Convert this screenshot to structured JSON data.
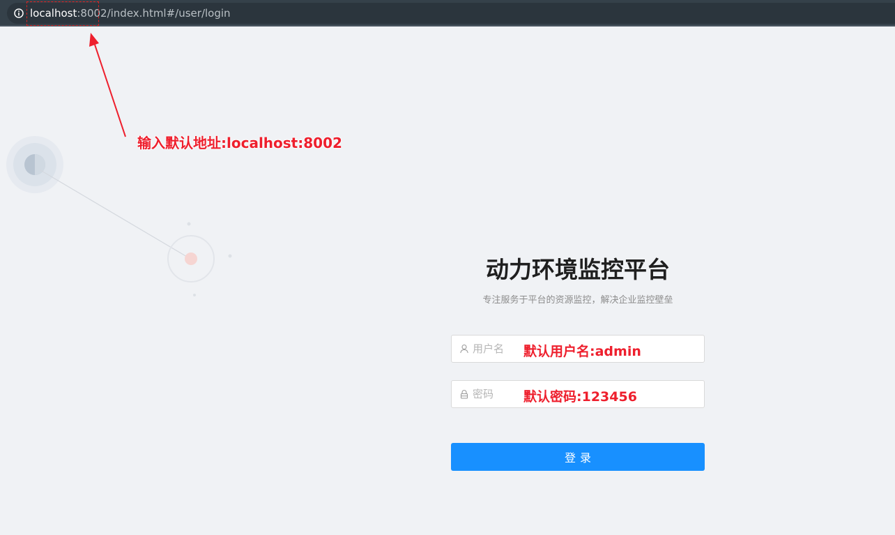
{
  "browser": {
    "url_host": "localhost",
    "url_rest": ":8002/index.html#/user/login"
  },
  "annotations": {
    "url_hint": "输入默认地址:localhost:8002",
    "username_hint": "默认用户名:admin",
    "password_hint": "默认密码:123456",
    "color": "#ee1f2d"
  },
  "login": {
    "title": "动力环境监控平台",
    "subtitle": "专注服务于平台的资源监控，解决企业监控壁垒",
    "username_placeholder": "用户名",
    "password_placeholder": "密码",
    "submit_label": "登录",
    "accent": "#1890ff"
  },
  "icons": {
    "address_bar": "info-icon",
    "username": "user-icon",
    "password": "lock-icon"
  }
}
